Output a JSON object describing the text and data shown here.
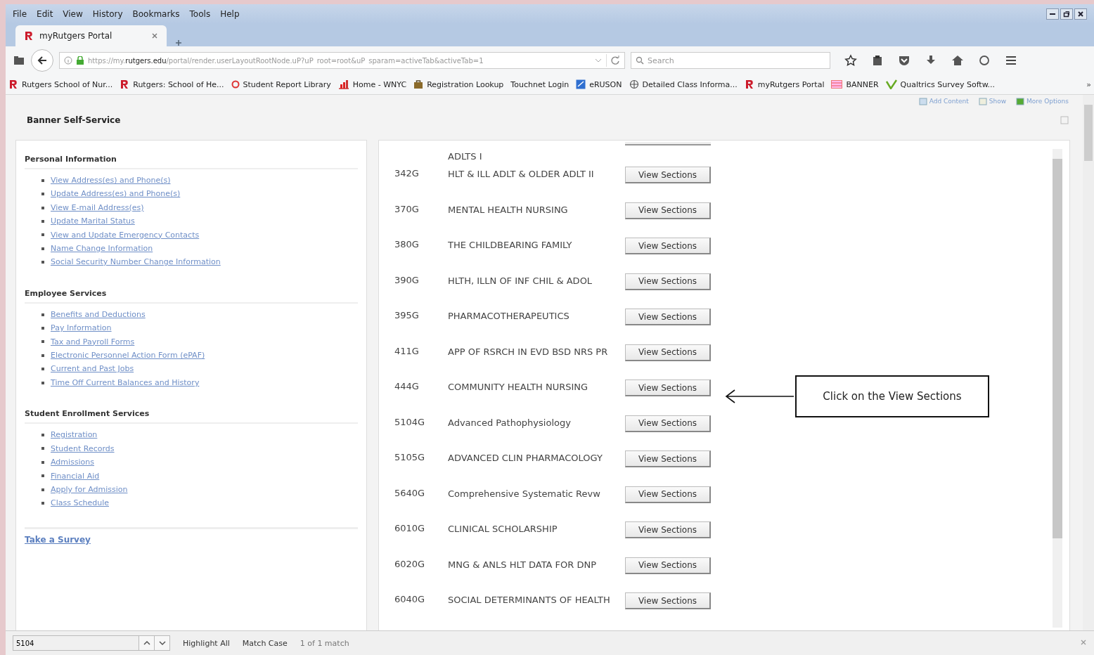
{
  "menu": [
    "File",
    "Edit",
    "View",
    "History",
    "Bookmarks",
    "Tools",
    "Help"
  ],
  "tabs": [
    {
      "title": "myRutgers Portal"
    }
  ],
  "address": {
    "url": "https://my.**rutgers.edu**/portal/render.userLayoutRootNode.uP?uP_root=root&uP_sparam=activeTab&activeTab=1"
  },
  "search": {
    "placeholder": "Search"
  },
  "bookmarks": [
    {
      "label": "Rutgers School of Nur...",
      "kind": "r-logo"
    },
    {
      "label": "Rutgers: School of He...",
      "kind": "r-logo"
    },
    {
      "label": "Student Report Library",
      "kind": "ring"
    },
    {
      "label": "Home - WNYC",
      "kind": "chart"
    },
    {
      "label": "Registration Lookup",
      "kind": "bag"
    },
    {
      "label": "Touchnet Login",
      "kind": "none"
    },
    {
      "label": "eRUSON",
      "kind": "square"
    },
    {
      "label": "Detailed Class Informa...",
      "kind": "globe"
    },
    {
      "label": "myRutgers Portal",
      "kind": "r-logo"
    },
    {
      "label": "BANNER",
      "kind": "flag"
    },
    {
      "label": "Qualtrics Survey Softw...",
      "kind": "check"
    }
  ],
  "bookmarks_overflow": "»",
  "portal_toolbar": [
    "Add Content",
    "Show",
    "More Options"
  ],
  "portlet_title": "Banner Self-Service",
  "sections": [
    {
      "heading": "Personal Information",
      "links": [
        "View Address(es) and Phone(s)",
        "Update Address(es) and Phone(s)",
        "View E-mail Address(es)",
        "Update Marital Status",
        "View and Update Emergency Contacts",
        "Name Change Information",
        "Social Security Number Change Information"
      ]
    },
    {
      "heading": "Employee Services",
      "links": [
        "Benefits and Deductions",
        "Pay Information",
        "Tax and Payroll Forms",
        "Electronic Personnel Action Form (ePAF)",
        "Current and Past Jobs",
        "Time Off Current Balances and History"
      ]
    },
    {
      "heading": "Student Enrollment Services",
      "links": [
        "Registration",
        "Student Records",
        "Admissions",
        "Financial Aid",
        "Apply for Admission",
        "Class Schedule"
      ]
    }
  ],
  "survey_link": "Take a Survey",
  "courses": {
    "continued_title": "ADLTS I",
    "rows": [
      {
        "code": "342G",
        "title": "HLT & ILL ADLT & OLDER ADLT II",
        "button": "View Sections"
      },
      {
        "code": "370G",
        "title": "MENTAL HEALTH NURSING",
        "button": "View Sections"
      },
      {
        "code": "380G",
        "title": "THE CHILDBEARING FAMILY",
        "button": "View Sections"
      },
      {
        "code": "390G",
        "title": "HLTH, ILLN OF INF CHIL & ADOL",
        "button": "View Sections"
      },
      {
        "code": "395G",
        "title": "PHARMACOTHERAPEUTICS",
        "button": "View Sections"
      },
      {
        "code": "411G",
        "title": "APP OF RSRCH IN EVD BSD NRS PR",
        "button": "View Sections"
      },
      {
        "code": "444G",
        "title": "COMMUNITY HEALTH NURSING",
        "button": "View Sections"
      },
      {
        "code": "5104G",
        "title": "Advanced Pathophysiology",
        "button": "View Sections"
      },
      {
        "code": "5105G",
        "title": "ADVANCED CLIN PHARMACOLOGY",
        "button": "View Sections"
      },
      {
        "code": "5640G",
        "title": "Comprehensive Systematic Revw",
        "button": "View Sections"
      },
      {
        "code": "6010G",
        "title": "CLINICAL SCHOLARSHIP",
        "button": "View Sections"
      },
      {
        "code": "6020G",
        "title": "MNG & ANLS HLT DATA FOR DNP",
        "button": "View Sections"
      },
      {
        "code": "6040G",
        "title": "SOCIAL DETERMINANTS OF HEALTH",
        "button": "View Sections"
      }
    ]
  },
  "callout": {
    "text": "Click on the View Sections"
  },
  "find_bar": {
    "value": "5104",
    "buttons": [
      "Highlight All",
      "Match Case"
    ],
    "status": "1 of 1 match"
  }
}
